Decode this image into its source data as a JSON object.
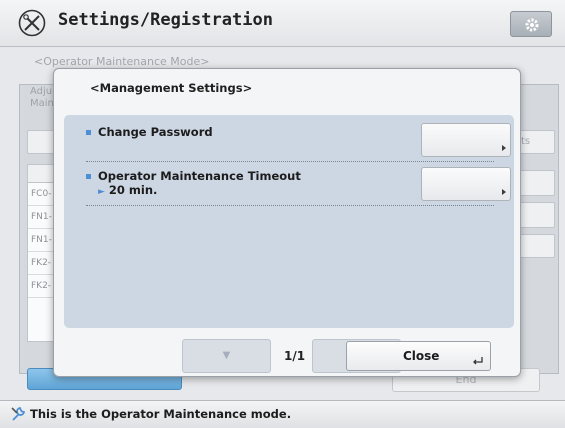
{
  "header": {
    "title": "Settings/Registration",
    "app_icon": "wrench-screwdriver-icon",
    "gear_icon": "gear-icon"
  },
  "background": {
    "breadcrumb": "<Operator Maintenance Mode>",
    "left_label_1": "Adju",
    "left_label_2": "Main",
    "right_btn_label": "ts",
    "list_rows": [
      "FC0-",
      "FN1-",
      "FN1-",
      "FK2-",
      "FK2-"
    ],
    "end_label": "End"
  },
  "dialog": {
    "title": "<Management Settings>",
    "rows": [
      {
        "label": "Change Password",
        "value": ""
      },
      {
        "label": "Operator Maintenance Timeout",
        "value": "20 min."
      }
    ],
    "page_indicator": "1/1",
    "close_label": "Close"
  },
  "status": {
    "icon": "wrench-icon",
    "text": "This is the Operator Maintenance mode."
  },
  "colors": {
    "accent": "#4d8fd4",
    "dialog_body": "#cdd6e3",
    "primary_button": "#6aaede"
  }
}
